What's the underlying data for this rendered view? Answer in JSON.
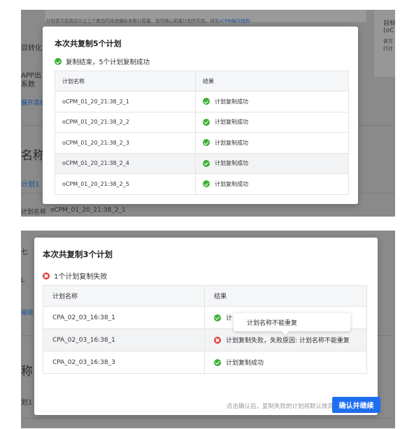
{
  "screenshot1": {
    "background": {
      "notice": "计划首次投放后计之三个数目内将进播标本限计投量，但可随心新建计划开实验，详见",
      "notice_link": "oCPM探行规则",
      "left_labels": [
        "目转化",
        "APP出",
        "系数",
        "展开高级"
      ],
      "right_card_title": "目标",
      "right_card_sub": "(oC",
      "right_card_lines": [
        "该方",
        "行计"
      ],
      "name_heading": "名称",
      "plan_link": "计划1",
      "plan_name_label": "计划名称",
      "plan_name_value": "oCPM_01_20_21:38_2_1"
    },
    "modal": {
      "title": "本次共复制5个计划",
      "status_text": "复制结束，5个计划复制成功",
      "columns": [
        "计划名称",
        "结果"
      ],
      "rows": [
        {
          "name": "oCPM_01_20_21:38_2_1",
          "result": "计划复制成功"
        },
        {
          "name": "oCPM_01_20_21:38_2_2",
          "result": "计划复制成功"
        },
        {
          "name": "oCPM_01_20_21:38_2_3",
          "result": "计划复制成功"
        },
        {
          "name": "oCPM_01_20_21:38_2_4",
          "result": "计划复制成功"
        },
        {
          "name": "oCPM_01_20_21:38_2_5",
          "result": "计划复制成功"
        }
      ]
    }
  },
  "screenshot2": {
    "background": {
      "left_labels": [
        "七",
        "L",
        "毫级"
      ],
      "name_heading": "称",
      "plan_link": "划1"
    },
    "modal": {
      "title": "本次共复制3个计划",
      "status_text": "1个计划复制失败",
      "columns": [
        "计划名称",
        "结果"
      ],
      "rows": [
        {
          "name": "CPA_02_03_16:38_1",
          "result": "计"
        },
        {
          "name": "CPA_02_03_16:38_1",
          "result": "计划复制失败，失败原因: 计划名称不能重复"
        },
        {
          "name": "CPA_02_03_16:38_3",
          "result": "计划复制成功"
        }
      ],
      "tooltip": "计划名称不能重复",
      "footer_note": "点击确认后，复制失败的计划将默认放弃",
      "confirm_button": "确认并继续"
    }
  },
  "colors": {
    "success": "#3cb034",
    "error": "#e04040",
    "primary": "#1f6ef0",
    "overlay": "#8a8a8a"
  }
}
